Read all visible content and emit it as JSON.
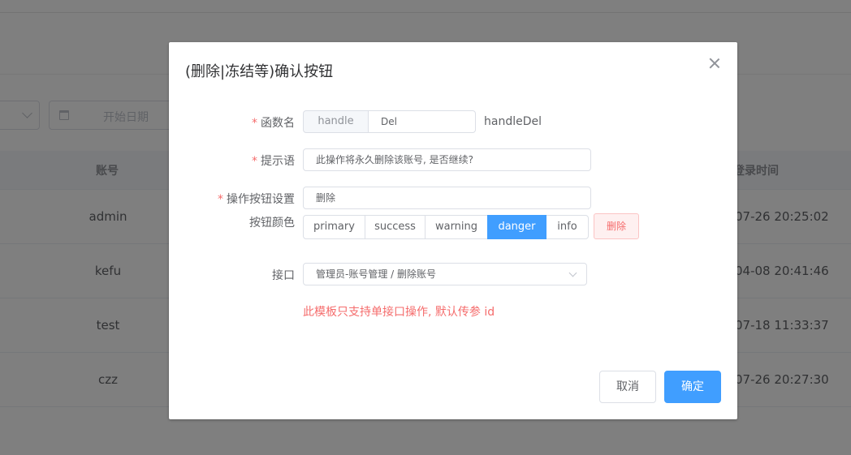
{
  "background": {
    "date_placeholder": "开始日期",
    "columns": {
      "account": "账号",
      "last_login": "登录时间"
    },
    "rows": [
      {
        "account": "admin",
        "last_login": "07-26 20:25:02"
      },
      {
        "account": "kefu",
        "last_login": "04-08 20:41:46"
      },
      {
        "account": "test",
        "last_login": "07-18 11:33:37"
      },
      {
        "account": "czz",
        "last_login": "07-26 20:27:30"
      }
    ]
  },
  "dialog": {
    "title": "(删除|冻结等)确认按钮",
    "required_mark": "*",
    "function_name": {
      "label": "函数名",
      "prefix": "handle",
      "value": "Del",
      "full_name": "handleDel"
    },
    "prompt": {
      "label": "提示语",
      "value": "此操作将永久删除该账号, 是否继续?"
    },
    "action_button": {
      "label": "操作按钮设置",
      "value": "删除"
    },
    "button_color": {
      "label": "按钮颜色",
      "options": [
        "primary",
        "success",
        "warning",
        "danger",
        "info"
      ],
      "selected": "danger",
      "preview_label": "删除"
    },
    "api": {
      "label": "接口",
      "value": "管理员-账号管理 / 删除账号"
    },
    "hint": "此模板只支持单接口操作, 默认传参 id",
    "cancel_label": "取消",
    "confirm_label": "确定"
  },
  "colors": {
    "primary": "#409eff",
    "danger": "#f56c6c",
    "overlay": "rgba(0,0,0,0.5)"
  }
}
